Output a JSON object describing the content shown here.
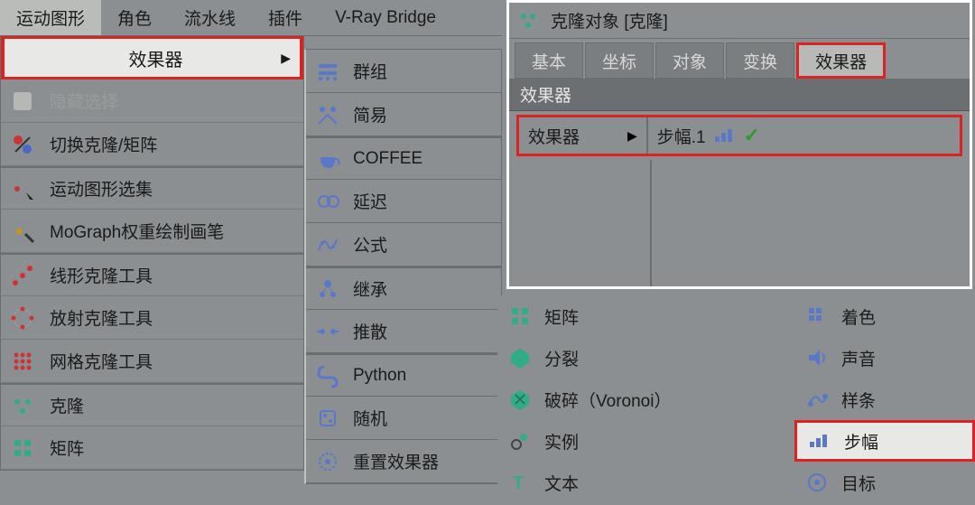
{
  "menubar": {
    "items": [
      "运动图形",
      "角色",
      "流水线",
      "插件",
      "V-Ray Bridge"
    ],
    "active_index": 0
  },
  "dropdown": {
    "effector_label": "效果器",
    "items": [
      {
        "label": "隐藏选择",
        "dim": true
      },
      {
        "label": "切换克隆/矩阵"
      },
      {
        "label": "运动图形选集",
        "sep": true
      },
      {
        "label": "MoGraph权重绘制画笔"
      },
      {
        "label": "线形克隆工具",
        "sep": true
      },
      {
        "label": "放射克隆工具"
      },
      {
        "label": "网格克隆工具"
      },
      {
        "label": "克隆",
        "sep": true
      },
      {
        "label": "矩阵"
      }
    ]
  },
  "submenu": {
    "items": [
      {
        "label": "群组"
      },
      {
        "label": "简易"
      },
      {
        "label": "COFFEE",
        "sep": true
      },
      {
        "label": "延迟"
      },
      {
        "label": "公式"
      },
      {
        "label": "继承",
        "sep": true
      },
      {
        "label": "推散"
      },
      {
        "label": "Python",
        "sep": true
      },
      {
        "label": "随机"
      },
      {
        "label": "重置效果器"
      }
    ]
  },
  "attr": {
    "title": "克隆对象 [克隆]",
    "tabs": [
      "基本",
      "坐标",
      "对象",
      "变换",
      "效果器"
    ],
    "selected_tab_index": 4,
    "section": "效果器",
    "field_label": "效果器",
    "field_value": "步幅.1"
  },
  "listB1": {
    "items": [
      {
        "label": "矩阵"
      },
      {
        "label": "分裂"
      },
      {
        "label": "破碎（Voronoi）"
      },
      {
        "label": "实例"
      },
      {
        "label": "文本"
      }
    ]
  },
  "listB2": {
    "items": [
      {
        "label": "着色"
      },
      {
        "label": "声音"
      },
      {
        "label": "样条"
      },
      {
        "label": "步幅",
        "selected": true
      },
      {
        "label": "目标"
      }
    ]
  }
}
